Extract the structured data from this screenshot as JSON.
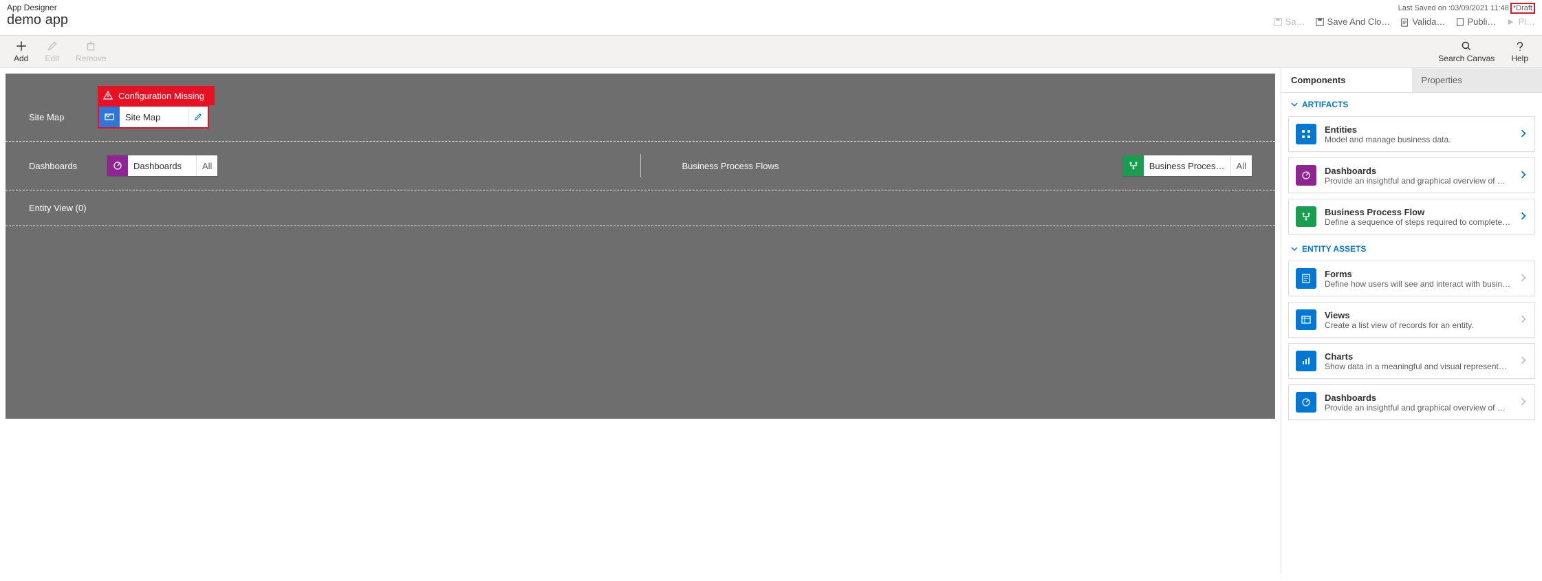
{
  "header": {
    "breadcrumb": "App Designer",
    "app_name": "demo app",
    "last_saved": "Last Saved on :03/09/2021 11:48",
    "draft_tag": "*Draft",
    "commands": {
      "save": "Sa…",
      "save_close": "Save And Clo…",
      "validate": "Valida…",
      "publish": "Publi…",
      "play": "Pl…"
    }
  },
  "toolbar": {
    "add": "Add",
    "edit": "Edit",
    "remove": "Remove",
    "search": "Search Canvas",
    "help": "Help"
  },
  "canvas": {
    "config_missing": "Configuration Missing",
    "site_map_label": "Site Map",
    "site_map_tile": "Site Map",
    "dashboards_label": "Dashboards",
    "dashboards_tile": "Dashboards",
    "dashboards_suffix": "All",
    "bpf_label": "Business Process Flows",
    "bpf_tile": "Business Proces…",
    "bpf_suffix": "All",
    "entity_view": "Entity View (0)"
  },
  "panel": {
    "tab_components": "Components",
    "tab_properties": "Properties",
    "group_artifacts": "ARTIFACTS",
    "group_entity_assets": "ENTITY ASSETS",
    "artifacts": [
      {
        "title": "Entities",
        "desc": "Model and manage business data.",
        "icon": "blue"
      },
      {
        "title": "Dashboards",
        "desc": "Provide an insightful and graphical overview of …",
        "icon": "purple"
      },
      {
        "title": "Business Process Flow",
        "desc": "Define a sequence of steps required to complete…",
        "icon": "green"
      }
    ],
    "assets": [
      {
        "title": "Forms",
        "desc": "Define how users will see and interact with busin…",
        "icon": "blue"
      },
      {
        "title": "Views",
        "desc": "Create a list view of records for an entity.",
        "icon": "blue"
      },
      {
        "title": "Charts",
        "desc": "Show data in a meaningful and visual representa…",
        "icon": "blue"
      },
      {
        "title": "Dashboards",
        "desc": "Provide an insightful and graphical overview of …",
        "icon": "blue"
      }
    ]
  }
}
